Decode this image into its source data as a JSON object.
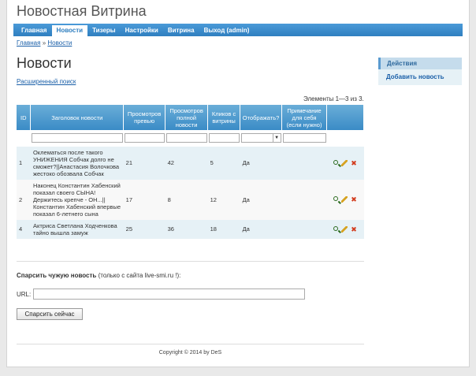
{
  "site": {
    "title": "Новостная Витрина"
  },
  "menu": [
    {
      "label": "Главная",
      "active": false
    },
    {
      "label": "Новости",
      "active": true
    },
    {
      "label": "Тизеры",
      "active": false
    },
    {
      "label": "Настройки",
      "active": false
    },
    {
      "label": "Витрина",
      "active": false
    },
    {
      "label": "Выход (admin)",
      "active": false
    }
  ],
  "breadcrumb": {
    "home": "Главная",
    "separator": "»",
    "current": "Новости"
  },
  "page_title": "Новости",
  "advanced_search": "Расширенный поиск",
  "summary": "Элементы 1—3 из 3.",
  "table": {
    "headers": [
      "ID",
      "Заголовок новости",
      "Просмотров превью",
      "Просмотров полной новости",
      "Кликов с витрины",
      "Отображать?",
      "Примечание для себя (если нужно)",
      ""
    ],
    "rows": [
      {
        "id": "1",
        "title": "Оклематься после такого УНИЖЕНИЯ Собчак долго не сможет?||Анастасия Волочкова жестоко обозвала Собчак",
        "preview": "21",
        "full": "42",
        "clicks": "5",
        "show": "Да",
        "note": ""
      },
      {
        "id": "2",
        "title": "Наконец Константин Хабенский показал своего СЫНА! Держитесь крепче - ОН...||Константин Хабенский впервые показал 6-летнего сына",
        "preview": "17",
        "full": "8",
        "clicks": "12",
        "show": "Да",
        "note": ""
      },
      {
        "id": "4",
        "title": "Актриса Светлана Ходченкова тайно вышла замуж",
        "preview": "25",
        "full": "36",
        "clicks": "18",
        "show": "Да",
        "note": ""
      }
    ]
  },
  "parse": {
    "title": "Спарсить чужую новость",
    "hint": "(только с сайта live-smi.ru !):",
    "url_label": "URL:",
    "url_value": "",
    "button": "Спарсить сейчас"
  },
  "footer": "Copyright © 2014 by DeS",
  "sidebar": {
    "title": "Действия",
    "link": "Добавить новость"
  },
  "colors": {
    "menu": "#2f7fc0",
    "table_header": "#4a9ad8",
    "link": "#1a5fa8"
  }
}
